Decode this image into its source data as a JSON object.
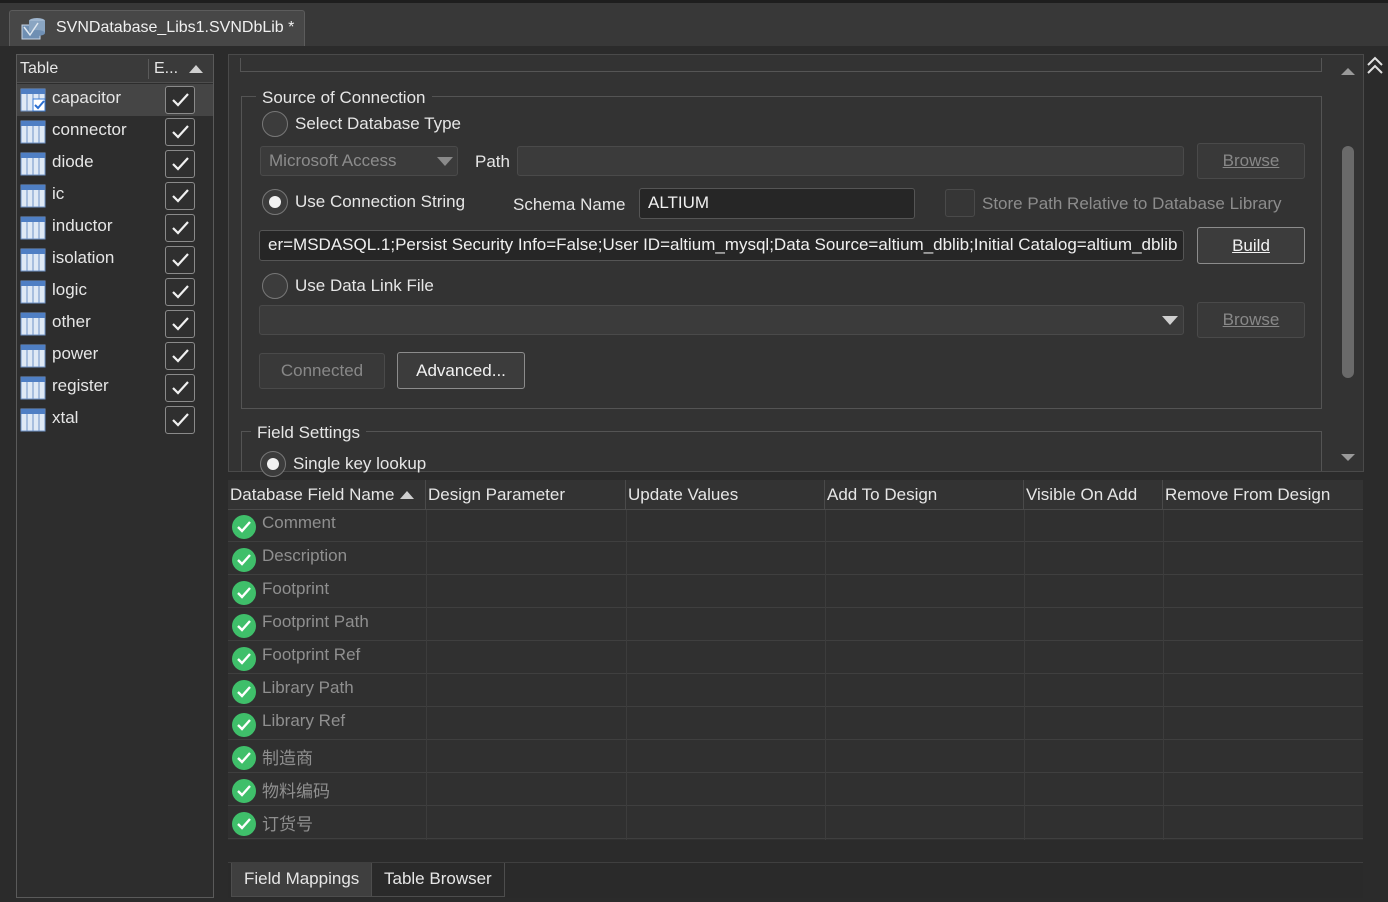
{
  "document_tab": {
    "title": "SVNDatabase_Libs1.SVNDbLib *"
  },
  "tables_panel": {
    "col_table": "Table",
    "col_enabled": "E...",
    "rows": [
      {
        "name": "capacitor",
        "enabled": true
      },
      {
        "name": "connector",
        "enabled": true
      },
      {
        "name": "diode",
        "enabled": true
      },
      {
        "name": "ic",
        "enabled": true
      },
      {
        "name": "inductor",
        "enabled": true
      },
      {
        "name": "isolation",
        "enabled": true
      },
      {
        "name": "logic",
        "enabled": true
      },
      {
        "name": "other",
        "enabled": true
      },
      {
        "name": "power",
        "enabled": true
      },
      {
        "name": "register",
        "enabled": true
      },
      {
        "name": "xtal",
        "enabled": true
      }
    ]
  },
  "connection": {
    "group_title": "Source of Connection",
    "select_db_type_label": "Select Database Type",
    "db_type_value": "Microsoft Access",
    "path_label": "Path",
    "path_value": "",
    "browse_label": "Browse",
    "use_conn_string_label": "Use Connection String",
    "schema_name_label": "Schema Name",
    "schema_name_value": "ALTIUM",
    "store_relative_label": "Store Path Relative to Database Library",
    "connection_string": "er=MSDASQL.1;Persist Security Info=False;User ID=altium_mysql;Data Source=altium_dblib;Initial Catalog=altium_dblib",
    "build_label": "Build",
    "use_data_link_label": "Use Data Link File",
    "data_link_value": "",
    "browse2_label": "Browse",
    "connected_label": "Connected",
    "advanced_label": "Advanced..."
  },
  "field_settings": {
    "group_title": "Field Settings",
    "single_key_label": "Single key lookup"
  },
  "grid": {
    "columns": [
      "Database Field Name",
      "Design Parameter",
      "Update Values",
      "Add To Design",
      "Visible On Add",
      "Remove From Design"
    ],
    "rows": [
      "Comment",
      "Description",
      "Footprint",
      "Footprint Path",
      "Footprint Ref",
      "Library Path",
      "Library Ref",
      "制造商",
      "物料编码",
      "订货号"
    ]
  },
  "bottom_tabs": [
    "Field Mappings",
    "Table Browser"
  ],
  "colors": {
    "ok_green": "#3fbf6a",
    "accent_blue": "#3a8ee6"
  }
}
